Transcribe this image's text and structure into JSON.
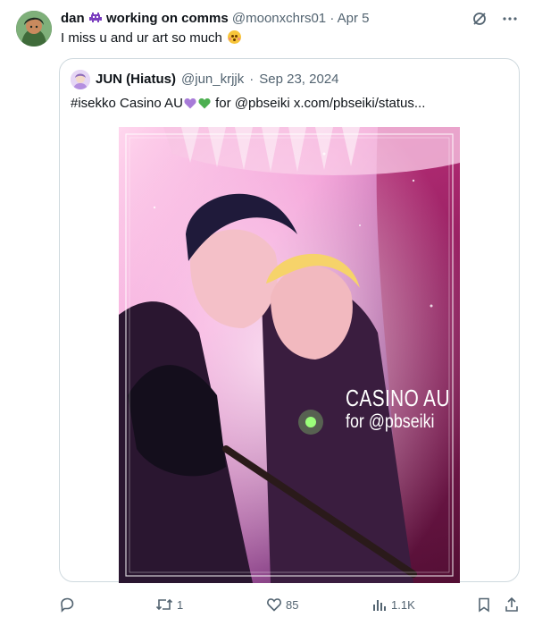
{
  "author": {
    "display_name_start": "dan",
    "display_name_end": "working on comms",
    "handle": "@moonxchrs01",
    "separator": "·",
    "date": "Apr 5",
    "avatar_icon": "avatar-icon"
  },
  "tweet": {
    "text": "I miss u and ur art so much"
  },
  "quoted": {
    "display_name": "JUN (Hiatus)",
    "handle": "@jun_krjjk",
    "separator": "·",
    "date": "Sep 23, 2024",
    "text_hashtag": "#isekko Casino AU",
    "text_rest": " for @pbseiki  x.com/pbseiki/status...",
    "image": {
      "title": "CASINO AU",
      "subtitle": "for @pbseiki"
    }
  },
  "actions": {
    "reply_count": "",
    "retweet_count": "1",
    "like_count": "85",
    "views_count": "1.1K"
  },
  "colors": {
    "text": "#0f1419",
    "muted": "#536471",
    "border": "#cfd9de",
    "purple_heart": "#a77bd8",
    "green_heart": "#4caf50",
    "grok_icon": "#536471"
  }
}
